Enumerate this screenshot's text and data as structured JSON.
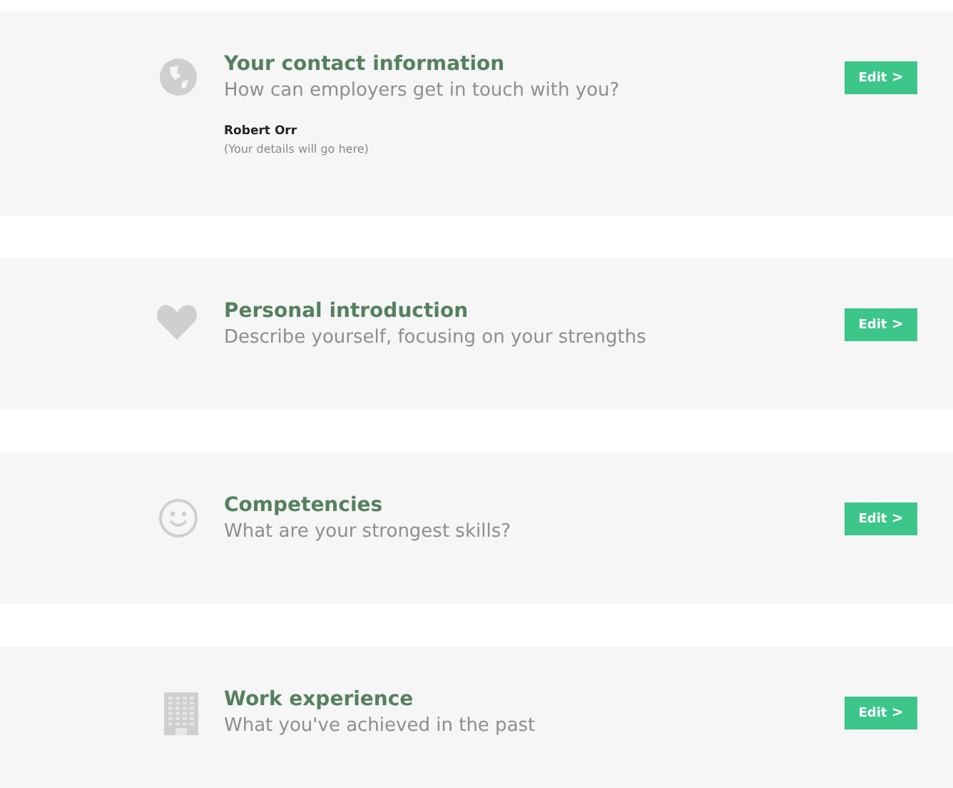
{
  "sections": [
    {
      "kind": "globe",
      "title": "Your contact information",
      "subtitle": "How can employers get in touch with you?",
      "name": "Robert Orr",
      "details": "(Your details will go here)",
      "button": "Edit",
      "button_icon": ">"
    },
    {
      "kind": "heart",
      "title": "Personal introduction",
      "subtitle": "Describe yourself, focusing on your strengths",
      "button": "Edit",
      "button_icon": ">"
    },
    {
      "kind": "smiley",
      "title": "Competencies",
      "subtitle": "What are your strongest skills?",
      "button": "Edit",
      "button_icon": ">"
    },
    {
      "kind": "building",
      "title": "Work experience",
      "subtitle": "What you've achieved in the past",
      "button": "Edit",
      "button_icon": ">"
    }
  ]
}
